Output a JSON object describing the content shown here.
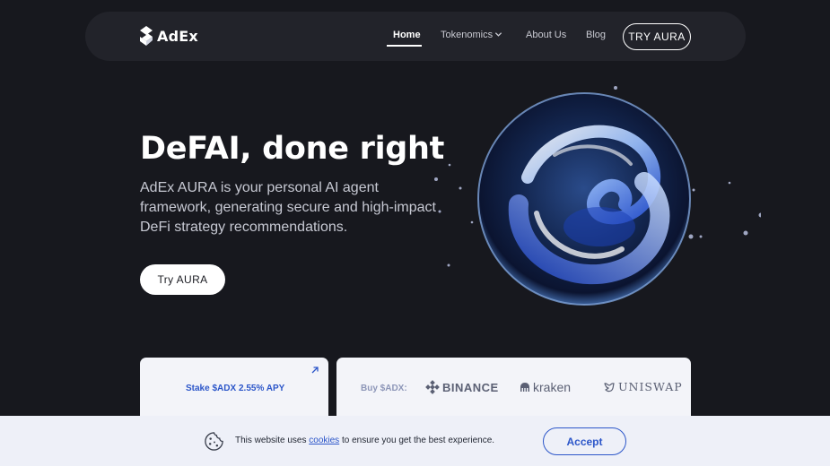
{
  "nav": {
    "logo_text": "AdEx",
    "links": [
      {
        "label": "Home",
        "active": true
      },
      {
        "label": "Tokenomics",
        "has_dropdown": true
      },
      {
        "label": "About Us"
      },
      {
        "label": "Blog"
      }
    ],
    "cta_label": "TRY AURA"
  },
  "hero": {
    "title": "DeFAI, done right",
    "description": "AdEx AURA is your personal AI agent framework, generating secure and high-impact DeFi strategy recommendations.",
    "button_label": "Try AURA"
  },
  "stake_card": {
    "label": "Stake $ADX",
    "apy": "2.55% APY",
    "icon": "arrow-up-right-icon"
  },
  "buy_card": {
    "label": "Buy $ADX:",
    "exchanges": [
      "BINANCE",
      "kraken",
      "UNISWAP"
    ]
  },
  "cookie_bar": {
    "text_before": "This website uses",
    "link_text": "cookies",
    "text_after": "to ensure you get the best experience.",
    "accept_label": "Accept"
  },
  "colors": {
    "background": "#17181e",
    "nav_bg": "#22232a",
    "accent_blue": "#2c56c9",
    "card_bg": "#f3f4f9",
    "cookie_bg": "#eef0f8"
  }
}
